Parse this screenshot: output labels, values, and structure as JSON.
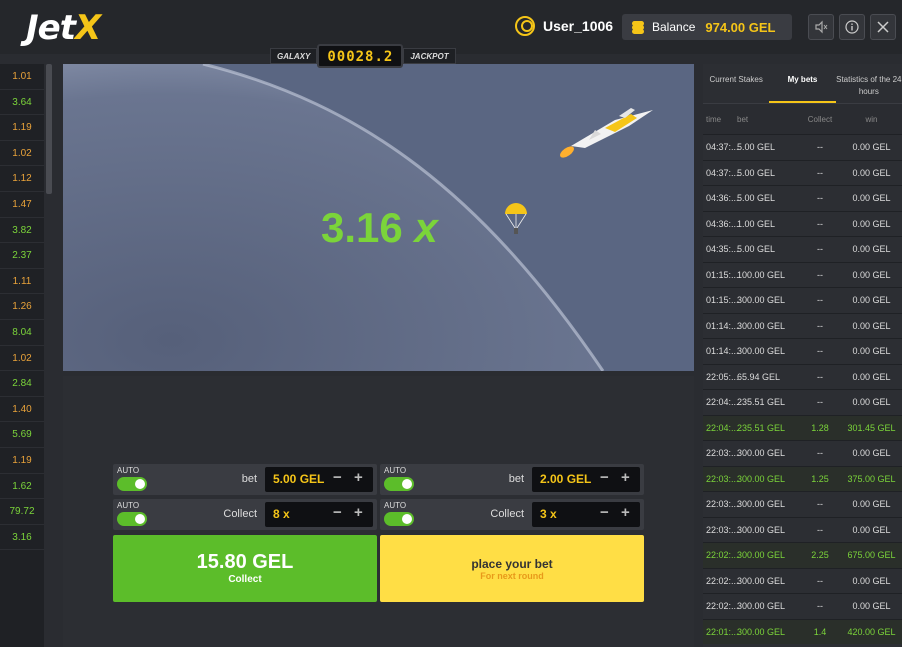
{
  "header": {
    "logo_main": "Jet",
    "logo_x": "X",
    "username": "User_1006",
    "balance_label": "Balance",
    "balance_value": "974.00 GEL"
  },
  "jackpot": {
    "left_label": "GALAXY",
    "value": "00028.2",
    "right_label": "JACKPOT"
  },
  "history": [
    {
      "v": "1.01",
      "c": "#e8a23a"
    },
    {
      "v": "3.64",
      "c": "#7bd43a"
    },
    {
      "v": "1.19",
      "c": "#e8a23a"
    },
    {
      "v": "1.02",
      "c": "#e8a23a"
    },
    {
      "v": "1.12",
      "c": "#e8a23a"
    },
    {
      "v": "1.47",
      "c": "#e8a23a"
    },
    {
      "v": "3.82",
      "c": "#7bd43a"
    },
    {
      "v": "2.37",
      "c": "#7bd43a"
    },
    {
      "v": "1.11",
      "c": "#e8a23a"
    },
    {
      "v": "1.26",
      "c": "#e8a23a"
    },
    {
      "v": "8.04",
      "c": "#7bd43a"
    },
    {
      "v": "1.02",
      "c": "#e8a23a"
    },
    {
      "v": "2.84",
      "c": "#7bd43a"
    },
    {
      "v": "1.40",
      "c": "#e8a23a"
    },
    {
      "v": "5.69",
      "c": "#7bd43a"
    },
    {
      "v": "1.19",
      "c": "#e8a23a"
    },
    {
      "v": "1.62",
      "c": "#7bd43a"
    },
    {
      "v": "79.72",
      "c": "#7bd43a"
    },
    {
      "v": "3.16",
      "c": "#7bd43a"
    }
  ],
  "game": {
    "multiplier": "3.16",
    "multiplier_suffix": "x"
  },
  "bet_panels": [
    {
      "auto_label": "AUTO",
      "bet_label": "bet",
      "bet_value": "5.00 GEL",
      "collect_label": "Collect",
      "collect_value": "8 x"
    },
    {
      "auto_label": "AUTO",
      "bet_label": "bet",
      "bet_value": "2.00 GEL",
      "collect_label": "Collect",
      "collect_value": "3 x"
    }
  ],
  "collect_button": {
    "amount": "15.80 GEL",
    "label": "Collect"
  },
  "place_button": {
    "title": "place your bet",
    "subtitle": "For next round"
  },
  "tabs": [
    {
      "label": "Current Stakes",
      "active": false
    },
    {
      "label": "My bets",
      "active": true
    },
    {
      "label": "Statistics of the 24 hours",
      "active": false
    }
  ],
  "table_headers": [
    "time",
    "bet",
    "Collect",
    "win"
  ],
  "bets": [
    {
      "time": "04:37:...",
      "bet": "5.00 GEL",
      "collect": "--",
      "win": "0.00 GEL",
      "won": false
    },
    {
      "time": "04:37:...",
      "bet": "5.00 GEL",
      "collect": "--",
      "win": "0.00 GEL",
      "won": false
    },
    {
      "time": "04:36:...",
      "bet": "5.00 GEL",
      "collect": "--",
      "win": "0.00 GEL",
      "won": false
    },
    {
      "time": "04:36:...",
      "bet": "1.00 GEL",
      "collect": "--",
      "win": "0.00 GEL",
      "won": false
    },
    {
      "time": "04:35:...",
      "bet": "5.00 GEL",
      "collect": "--",
      "win": "0.00 GEL",
      "won": false
    },
    {
      "time": "01:15:...",
      "bet": "100.00 GEL",
      "collect": "--",
      "win": "0.00 GEL",
      "won": false
    },
    {
      "time": "01:15:...",
      "bet": "300.00 GEL",
      "collect": "--",
      "win": "0.00 GEL",
      "won": false
    },
    {
      "time": "01:14:...",
      "bet": "300.00 GEL",
      "collect": "--",
      "win": "0.00 GEL",
      "won": false
    },
    {
      "time": "01:14:...",
      "bet": "300.00 GEL",
      "collect": "--",
      "win": "0.00 GEL",
      "won": false
    },
    {
      "time": "22:05:...",
      "bet": "65.94 GEL",
      "collect": "--",
      "win": "0.00 GEL",
      "won": false
    },
    {
      "time": "22:04:...",
      "bet": "235.51 GEL",
      "collect": "--",
      "win": "0.00 GEL",
      "won": false
    },
    {
      "time": "22:04:...",
      "bet": "235.51 GEL",
      "collect": "1.28",
      "win": "301.45 GEL",
      "won": true
    },
    {
      "time": "22:03:...",
      "bet": "300.00 GEL",
      "collect": "--",
      "win": "0.00 GEL",
      "won": false
    },
    {
      "time": "22:03:...",
      "bet": "300.00 GEL",
      "collect": "1.25",
      "win": "375.00 GEL",
      "won": true
    },
    {
      "time": "22:03:...",
      "bet": "300.00 GEL",
      "collect": "--",
      "win": "0.00 GEL",
      "won": false
    },
    {
      "time": "22:03:...",
      "bet": "300.00 GEL",
      "collect": "--",
      "win": "0.00 GEL",
      "won": false
    },
    {
      "time": "22:02:...",
      "bet": "300.00 GEL",
      "collect": "2.25",
      "win": "675.00 GEL",
      "won": true
    },
    {
      "time": "22:02:...",
      "bet": "300.00 GEL",
      "collect": "--",
      "win": "0.00 GEL",
      "won": false
    },
    {
      "time": "22:02:...",
      "bet": "300.00 GEL",
      "collect": "--",
      "win": "0.00 GEL",
      "won": false
    },
    {
      "time": "22:01:...",
      "bet": "300.00 GEL",
      "collect": "1.4",
      "win": "420.00 GEL",
      "won": true
    }
  ]
}
